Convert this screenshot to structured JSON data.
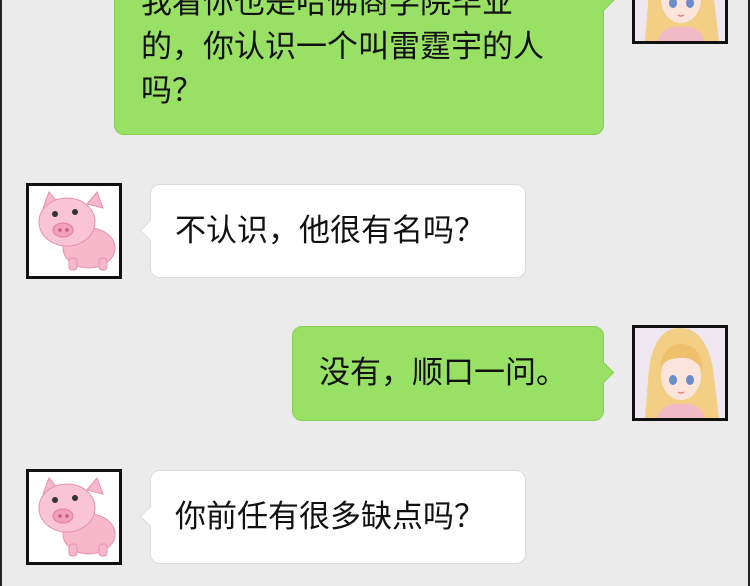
{
  "messages": [
    {
      "side": "sent",
      "lines": [
        "我看你也是哈佛商学院毕业",
        "的，你认识一个叫雷霆宇的人",
        "吗？"
      ],
      "avatar": "blonde-girl-avatar"
    },
    {
      "side": "received",
      "lines": [
        "不认识，他很有名吗？"
      ],
      "avatar": "pink-pig-avatar"
    },
    {
      "side": "sent",
      "lines": [
        "没有，顺口一问。"
      ],
      "avatar": "blonde-girl-avatar"
    },
    {
      "side": "received",
      "lines": [
        "你前任有很多缺点吗？"
      ],
      "avatar": "pink-pig-avatar"
    }
  ],
  "colors": {
    "background": "#ebebeb",
    "sent_bubble": "#98e165",
    "received_bubble": "#ffffff",
    "pig_pink": "#f7b8cc",
    "hair_blonde": "#f3cf86"
  }
}
